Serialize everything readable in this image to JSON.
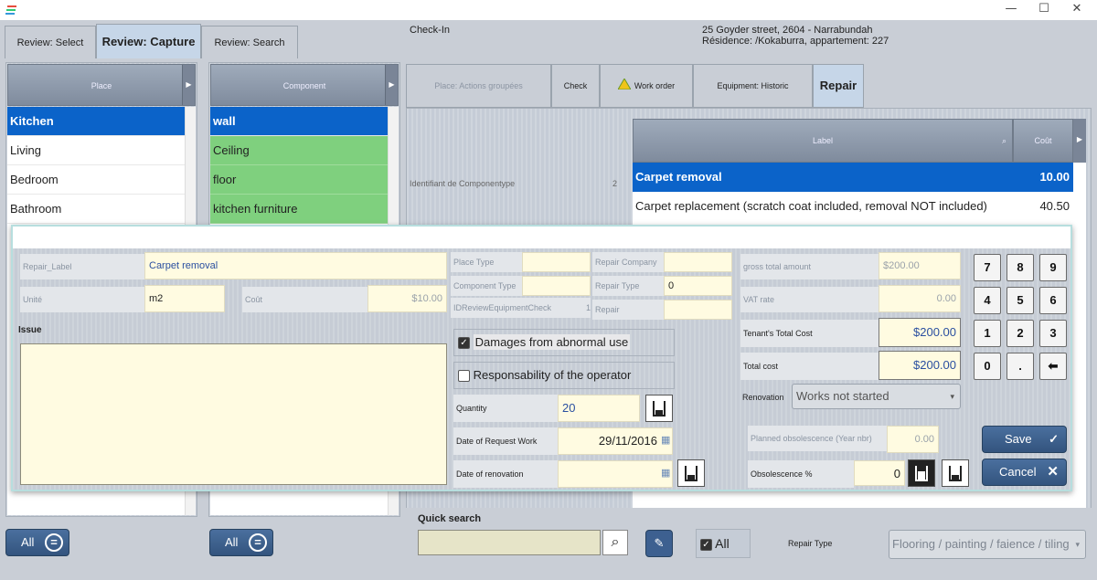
{
  "window": {
    "minimize": "—",
    "maximize": "☐",
    "close": "✕"
  },
  "header": {
    "tabs": [
      {
        "label": "Review: Select",
        "active": false
      },
      {
        "label": "Review: Capture",
        "active": true
      },
      {
        "label": "Review: Search",
        "active": false
      }
    ],
    "context_title": "Check-In",
    "address_line1": "25 Goyder street, 2604 - Narrabundah",
    "address_line2": "Résidence: /Kokaburra, appartement: 227"
  },
  "place_list": {
    "header": "Place",
    "items": [
      "Kitchen",
      "Living",
      "Bedroom",
      "Bathroom"
    ],
    "selected": "Kitchen"
  },
  "component_list": {
    "header": "Component",
    "items": [
      "wall",
      "Ceiling",
      "floor",
      "kitchen furniture"
    ],
    "selected": "wall"
  },
  "right_tabs": [
    {
      "label": "Place: Actions groupées",
      "dim": true
    },
    {
      "label": "Check",
      "dim": false
    },
    {
      "label": "Work order",
      "dim": false,
      "icon": "warning-triangle-icon"
    },
    {
      "label": "Equipment: Historic",
      "dim": false
    },
    {
      "label": "Repair",
      "active": true
    }
  ],
  "component_info": {
    "label": "Identifiant de Componentype",
    "value": "2"
  },
  "repair_table": {
    "columns": [
      "Label",
      "Coût"
    ],
    "rows": [
      {
        "label": "Carpet removal",
        "cost": "10.00",
        "selected": true
      },
      {
        "label": "Carpet replacement (scratch coat included, removal NOT included)",
        "cost": "40.50",
        "selected": false
      }
    ]
  },
  "dialog": {
    "repair_label": {
      "label": "Repair_Label",
      "value": "Carpet removal"
    },
    "unite": {
      "label": "Unité",
      "value": "m2"
    },
    "cout": {
      "label": "Coût",
      "value": "$10.00"
    },
    "issue_label": "Issue",
    "issue_text": "",
    "place_type": {
      "label": "Place Type",
      "value": ""
    },
    "component_type": {
      "label": "Component Type",
      "value": ""
    },
    "id_review": {
      "label": "IDReviewEquipmentCheck",
      "value": "1"
    },
    "repair_company": {
      "label": "Repair Company",
      "value": ""
    },
    "repair_type": {
      "label": "Repair Type",
      "value": "0"
    },
    "repair": {
      "label": "Repair",
      "value": ""
    },
    "damages_checkbox": {
      "label": "Damages from abnormal use",
      "checked": true
    },
    "responsability_checkbox": {
      "label": "Responsability of the operator",
      "checked": false
    },
    "quantity": {
      "label": "Quantity",
      "value": "20"
    },
    "date_request": {
      "label": "Date of Request Work",
      "value": "29/11/2016"
    },
    "date_renovation": {
      "label": "Date of renovation",
      "value": ""
    },
    "gross_total": {
      "label": "gross total amount",
      "value": "$200.00"
    },
    "vat_rate": {
      "label": "VAT rate",
      "value": "0.00"
    },
    "tenant_cost": {
      "label": "Tenant's Total Cost",
      "value": "$200.00"
    },
    "total_cost": {
      "label": "Total cost",
      "value": "$200.00"
    },
    "renovation": {
      "label": "Renovation",
      "value": "Works not started"
    },
    "planned_obsolescence": {
      "label": "Planned obsolescence (Year nbr)",
      "value": "0.00"
    },
    "obsolescence": {
      "label": "Obsolescence %",
      "value": "0"
    },
    "keypad": [
      "7",
      "8",
      "9",
      "4",
      "5",
      "6",
      "1",
      "2",
      "3",
      "0",
      ".",
      "⬅"
    ],
    "save_label": "Save",
    "cancel_label": "Cancel"
  },
  "footer": {
    "all_place": "All",
    "all_component": "All",
    "quick_search_label": "Quick search",
    "quick_search_value": "",
    "all_check_label": "All",
    "all_checked": true,
    "repair_type_label": "Repair Type",
    "repair_type_value": "Flooring / painting / faience / tiling"
  },
  "colors": {
    "selected_blue": "#0b63c9",
    "green_row": "#7fd07e",
    "field_yellow": "#fffbe1",
    "button_blue": "#3d6090"
  }
}
